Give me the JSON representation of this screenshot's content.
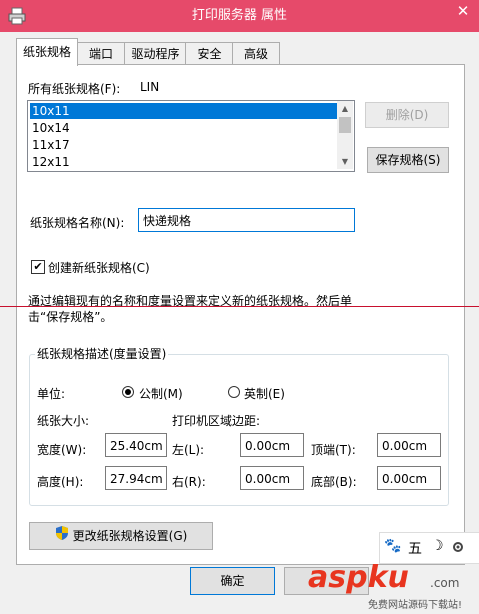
{
  "window": {
    "title": "打印服务器 属性",
    "close_glyph": "✕"
  },
  "tabs": [
    {
      "label": "纸张规格"
    },
    {
      "label": "端口"
    },
    {
      "label": "驱动程序"
    },
    {
      "label": "安全"
    },
    {
      "label": "高级"
    }
  ],
  "forms": {
    "all_label": "所有纸张规格(F):",
    "server_name": "LIN",
    "items": [
      "10x11",
      "10x14",
      "11x17",
      "12x11"
    ],
    "delete_label": "删除(D)",
    "save_label": "保存规格(S)",
    "name_label": "纸张规格名称(N):",
    "name_value": "快递规格",
    "create_label": "创建新纸张规格(C)",
    "create_checked": true,
    "check_glyph": "✔",
    "desc_line1": "通过编辑现有的名称和度量设置来定义新的纸张规格。然后单",
    "desc_line2": "击“保存规格”。"
  },
  "measure": {
    "group_title": "纸张规格描述(度量设置)",
    "unit_label": "单位:",
    "metric_label": "公制(M)",
    "english_label": "英制(E)",
    "metric_selected": true,
    "paper_size_label": "纸张大小:",
    "margins_label": "打印机区域边距:",
    "width_label": "宽度(W):",
    "width_value": "25.40cm",
    "height_label": "高度(H):",
    "height_value": "27.94cm",
    "left_label": "左(L):",
    "left_value": "0.00cm",
    "right_label": "右(R):",
    "right_value": "0.00cm",
    "top_label": "顶端(T):",
    "top_value": "0.00cm",
    "bottom_label": "底部(B):",
    "bottom_value": "0.00cm"
  },
  "footer": {
    "change_settings_label": "更改纸张规格设置(G)",
    "ok_label": "确定"
  },
  "ime": {
    "mode": "五",
    "glyphs": [
      "🐾",
      "☽"
    ]
  },
  "watermark": {
    "brand": "aspku",
    "sub": "免费网站源码下载站!",
    "com": ".com"
  },
  "colors": {
    "titlebar": "#e64a6a",
    "selection": "#0078d7",
    "watermark": "#e8351f"
  }
}
